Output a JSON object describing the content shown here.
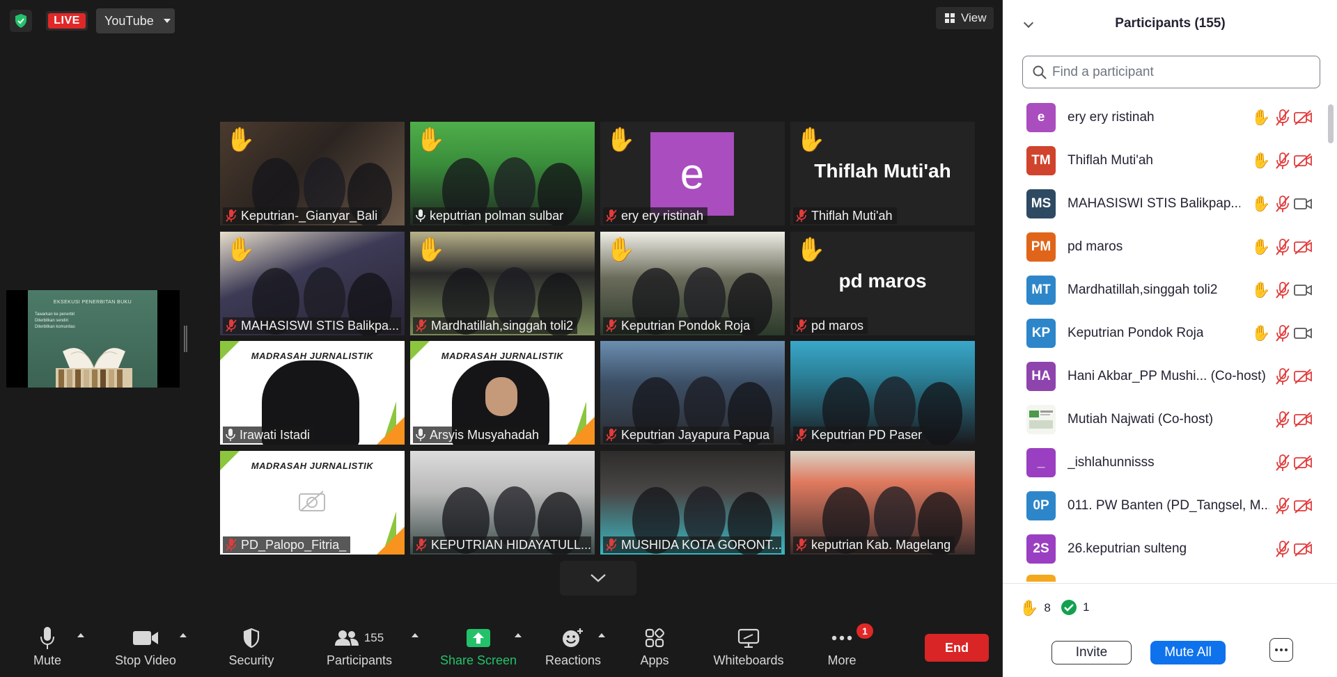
{
  "topbar": {
    "live_label": "LIVE",
    "stream_target": "YouTube",
    "view_label": "View"
  },
  "shared_screen": {
    "slide_title": "EKSEKUSI PENERBITAN BUKU",
    "bullets": [
      "Tawarkan ke penerbit",
      "Diterbitkan sendiri",
      "Diterbitkan komunitas"
    ]
  },
  "gallery": {
    "tiles": [
      {
        "name": "Keputrian-_Gianyar_Bali",
        "hand": true,
        "mic": "muted"
      },
      {
        "name": "keputrian polman sulbar",
        "hand": true,
        "mic": "active"
      },
      {
        "name": "ery ery ristinah",
        "hand": true,
        "mic": "muted",
        "avatar_letter": "e"
      },
      {
        "name": "Thiflah Muti'ah",
        "hand": true,
        "mic": "muted",
        "display_name": "Thiflah Muti'ah"
      },
      {
        "name": "MAHASISWI STIS Balikpa...",
        "hand": true,
        "mic": "muted"
      },
      {
        "name": "Mardhatillah,singgah toli2",
        "hand": true,
        "mic": "muted"
      },
      {
        "name": "Keputrian Pondok Roja",
        "hand": true,
        "mic": "muted"
      },
      {
        "name": "pd maros",
        "hand": true,
        "mic": "muted",
        "display_name": "pd maros"
      },
      {
        "name": "Irawati Istadi",
        "hand": false,
        "mic": "active",
        "banner": "MADRASAH JURNALISTIK"
      },
      {
        "name": "Arsyis Musyahadah",
        "hand": false,
        "mic": "active",
        "banner": "MADRASAH JURNALISTIK"
      },
      {
        "name": "Keputrian Jayapura Papua",
        "hand": false,
        "mic": "muted"
      },
      {
        "name": "Keputrian PD Paser",
        "hand": false,
        "mic": "muted"
      },
      {
        "name": "PD_Palopo_Fitria_",
        "hand": false,
        "mic": "muted",
        "banner": "MADRASAH JURNALISTIK"
      },
      {
        "name": "KEPUTRIAN HIDAYATULL...",
        "hand": false,
        "mic": "muted"
      },
      {
        "name": "MUSHIDA KOTA GORONT...",
        "hand": false,
        "mic": "muted"
      },
      {
        "name": "keputrian Kab. Magelang",
        "hand": false,
        "mic": "muted"
      }
    ]
  },
  "toolbar": {
    "mute": "Mute",
    "stop_video": "Stop Video",
    "security": "Security",
    "participants": "Participants",
    "participants_count": "155",
    "share_screen": "Share Screen",
    "reactions": "Reactions",
    "apps": "Apps",
    "whiteboards": "Whiteboards",
    "more": "More",
    "more_badge": "1",
    "end": "End"
  },
  "panel": {
    "title": "Participants (155)",
    "search_placeholder": "Find a participant",
    "participants": [
      {
        "initials": "e",
        "color": "#a94dbf",
        "name": "ery ery ristinah",
        "hand": true,
        "video": "off"
      },
      {
        "initials": "TM",
        "color": "#d0432c",
        "name": "Thiflah Muti'ah",
        "hand": true,
        "video": "off"
      },
      {
        "initials": "MS",
        "color": "#2e4a63",
        "name": "MAHASISWI STIS Balikpap...",
        "hand": true,
        "video": "on"
      },
      {
        "initials": "PM",
        "color": "#e0651a",
        "name": "pd maros",
        "hand": true,
        "video": "off"
      },
      {
        "initials": "MT",
        "color": "#2d86c9",
        "name": "Mardhatillah,singgah toli2",
        "hand": true,
        "video": "on"
      },
      {
        "initials": "KP",
        "color": "#2d86c9",
        "name": "Keputrian Pondok Roja",
        "hand": true,
        "video": "on"
      },
      {
        "initials": "HA",
        "color": "#8e44ad",
        "name": "Hani Akbar_PP Mushi... (Co-host)",
        "hand": false,
        "video": "off"
      },
      {
        "initials": "",
        "color": "#e8f1e4",
        "name": "Mutiah Najwati (Co-host)",
        "hand": false,
        "video": "off"
      },
      {
        "initials": "_",
        "color": "#9b3fc2",
        "name": "_ishlahunnisss",
        "hand": false,
        "video": "off"
      },
      {
        "initials": "0P",
        "color": "#2d86c9",
        "name": "011. PW Banten (PD_Tangsel, M...",
        "hand": false,
        "video": "off"
      },
      {
        "initials": "2S",
        "color": "#9b3fc2",
        "name": "26.keputrian sulteng",
        "hand": false,
        "video": "off"
      }
    ],
    "raised_hands": "8",
    "yes_count": "1",
    "invite": "Invite",
    "mute_all": "Mute All"
  }
}
